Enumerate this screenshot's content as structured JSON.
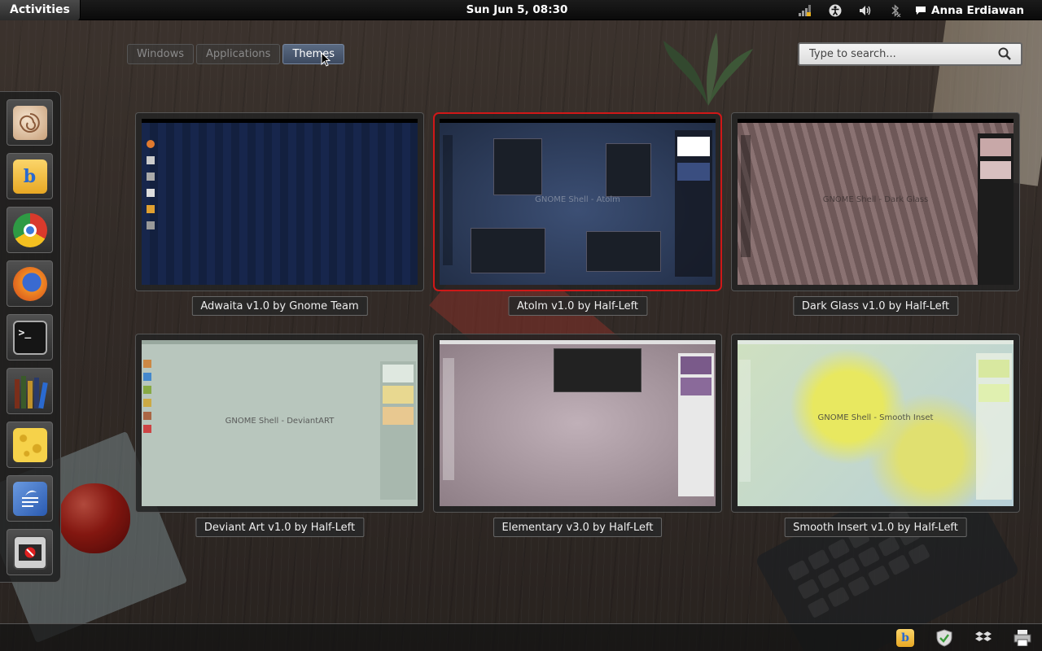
{
  "topbar": {
    "activities": "Activities",
    "clock": "Sun Jun  5, 08:30",
    "user": "Anna Erdiawan",
    "tray_icons": [
      "network-icon",
      "accessibility-icon",
      "volume-icon",
      "bluetooth-icon"
    ]
  },
  "views": {
    "windows": "Windows",
    "applications": "Applications",
    "themes": "Themes",
    "active": "Themes"
  },
  "search": {
    "placeholder": "Type to search..."
  },
  "dash": {
    "items": [
      {
        "name": "nautilus-icon",
        "color": "#e6c6a6"
      },
      {
        "name": "bubble-icon",
        "color": "#f2c14a"
      },
      {
        "name": "chrome-icon",
        "color": "#3e8ed6"
      },
      {
        "name": "firefox-icon",
        "color": "#e27a2e"
      },
      {
        "name": "terminal-icon",
        "color": "#1e1e1e"
      },
      {
        "name": "library-icon",
        "color": "#6b3a24"
      },
      {
        "name": "cheese-icon",
        "color": "#f3c93e"
      },
      {
        "name": "writer-icon",
        "color": "#4b7fd0"
      },
      {
        "name": "system-monitor-icon",
        "color": "#c8c8c8"
      }
    ]
  },
  "themes": [
    {
      "label": "Adwaita v1.0 by Gnome Team",
      "preview_title": "",
      "bg": "#15244a",
      "accent": "#0d1836",
      "selected": false
    },
    {
      "label": "Atolm v1.0 by Half-Left",
      "preview_title": "GNOME Shell - Atolm",
      "bg": "#2d3d5c",
      "accent": "#1d2740",
      "selected": true
    },
    {
      "label": "Dark Glass v1.0 by Half-Left",
      "preview_title": "GNOME Shell - Dark Glass",
      "bg": "#7a6262",
      "accent": "#4a3a3a",
      "selected": false
    },
    {
      "label": "Deviant Art v1.0 by Half-Left",
      "preview_title": "GNOME Shell - DeviantART",
      "bg": "#b9c8bf",
      "accent": "#9fb2a6",
      "selected": false
    },
    {
      "label": "Elementary v3.0 by Half-Left",
      "preview_title": "",
      "bg": "#a6969e",
      "accent": "#c6b6bc",
      "selected": false
    },
    {
      "label": "Smooth Insert v1.0 by Half-Left",
      "preview_title": "GNOME Shell - Smooth Inset",
      "bg": "#c8d8a8",
      "accent": "#e2e8a0",
      "selected": false
    }
  ],
  "bottom_tray": [
    "bubble-tray-icon",
    "shield-tray-icon",
    "dropbox-tray-icon",
    "printer-tray-icon"
  ],
  "colors": {
    "selection": "#d01818",
    "active_tab": "#4a5a74"
  }
}
